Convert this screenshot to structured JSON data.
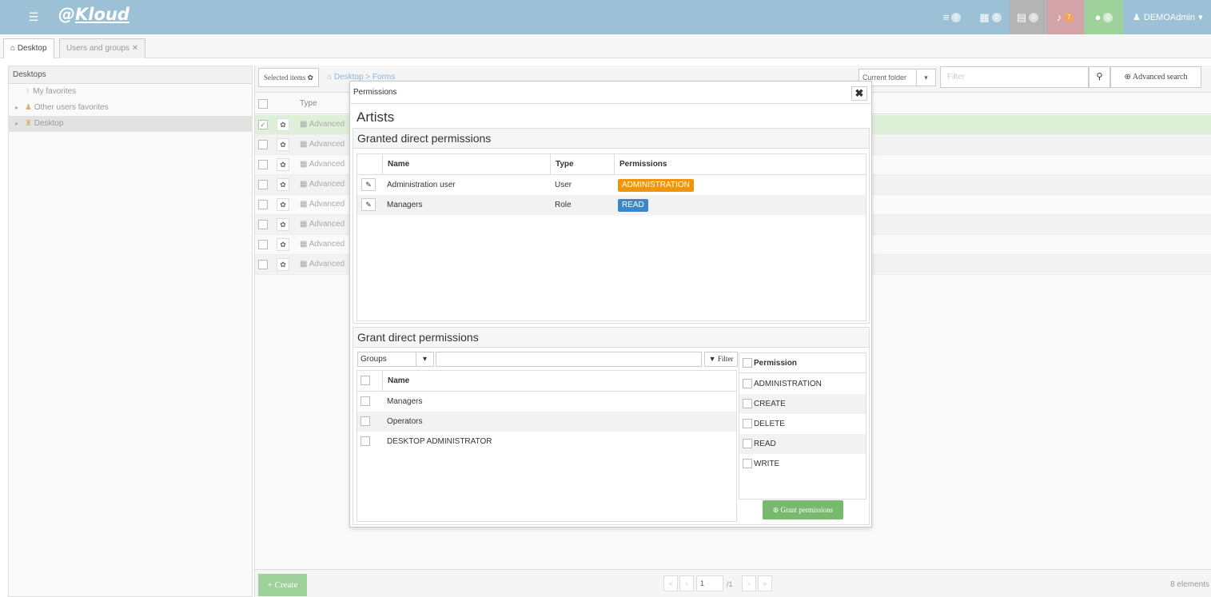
{
  "app": {
    "logo_prefix": "@",
    "logo_name": "Kloud",
    "user": "DEMOAdmin"
  },
  "top_icons": [
    {
      "icon": "list-icon",
      "count": "0",
      "color": "#9cc0d6"
    },
    {
      "icon": "calendar-icon",
      "count": "0",
      "color": "#9cc0d6"
    },
    {
      "icon": "inbox-icon",
      "count": "0",
      "color": "#b0b0b0"
    },
    {
      "icon": "bell-icon",
      "count": "7",
      "color": "#d4a3a8"
    },
    {
      "icon": "chat-icon",
      "count": "0",
      "color": "#9fd19a"
    }
  ],
  "tabs": [
    {
      "label": "Desktop"
    },
    {
      "label": "Users and groups"
    }
  ],
  "left": {
    "header": "Desktops",
    "items": [
      "My favorites",
      "Other users favorites",
      "Desktop"
    ]
  },
  "toolbar": {
    "selected_items": "Selected items",
    "crumb_home": "Desktop",
    "crumb_sep": ">",
    "crumb_page": "Forms",
    "current_folder": "Current folder",
    "filter_placeholder": "Filter",
    "advanced_search": "Advanced search"
  },
  "grid": {
    "type_header": "Type",
    "row_type": "Advanced"
  },
  "footer": {
    "create": "Create",
    "page": "1",
    "total_pages": "/1",
    "elements": "8 elements"
  },
  "modal": {
    "title": "Permissions",
    "subject": "Artists",
    "granted_title": "Granted direct permissions",
    "granted_cols": [
      "Name",
      "Type",
      "Permissions"
    ],
    "granted_rows": [
      {
        "name": "Administration user",
        "type": "User",
        "perm": "ADMINISTRATION",
        "color": "#f0940a"
      },
      {
        "name": "Managers",
        "type": "Role",
        "perm": "READ",
        "color": "#3b87c8"
      }
    ],
    "grant_title": "Grant direct permissions",
    "groups_select": "Groups",
    "filter_btn": "Filter",
    "name_col": "Name",
    "groups": [
      "Managers",
      "Operators",
      "DESKTOP ADMINISTRATOR"
    ],
    "perm_col": "Permission",
    "perms": [
      "ADMINISTRATION",
      "CREATE",
      "DELETE",
      "READ",
      "WRITE"
    ],
    "grant_btn": "Grant permissions"
  }
}
